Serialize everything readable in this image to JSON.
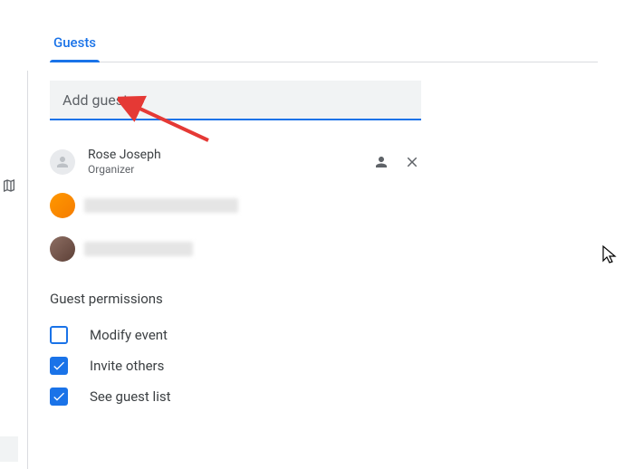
{
  "tab": {
    "guests_label": "Guests"
  },
  "input": {
    "add_guests_placeholder": "Add guests"
  },
  "guests": [
    {
      "name": "Rose Joseph",
      "role": "Organizer"
    }
  ],
  "permissions": {
    "title": "Guest permissions",
    "items": [
      {
        "label": "Modify event",
        "checked": false
      },
      {
        "label": "Invite others",
        "checked": true
      },
      {
        "label": "See guest list",
        "checked": true
      }
    ]
  }
}
